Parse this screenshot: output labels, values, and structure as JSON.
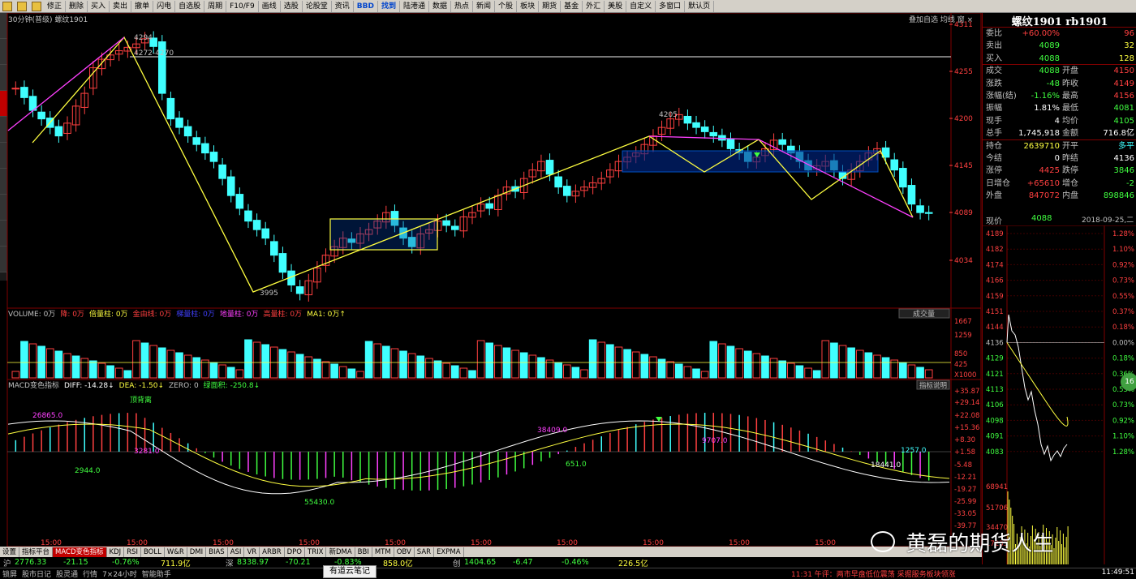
{
  "toolbar": {
    "items": [
      "修正",
      "删除",
      "买入",
      "卖出",
      "撤单",
      "闪电",
      "自选股",
      "周期",
      "F10/F9",
      "画线",
      "选股",
      "论股堂",
      "资讯",
      "BBD",
      "找到",
      "陆港通",
      "数据",
      "热点",
      "新闻",
      "个股",
      "板块",
      "期货",
      "基金",
      "外汇",
      "美股",
      "自定义",
      "多窗口",
      "默认页"
    ]
  },
  "chart": {
    "title": "30分钟(普级) 螺纹1901",
    "tools": "叠加自选 均线 窗 ×",
    "price_axis": [
      "4311",
      "4255",
      "4200",
      "4145",
      "4089",
      "4034"
    ],
    "annotations": {
      "high": "4294",
      "range": "4272-4270",
      "low": "3995",
      "mid": "4205"
    }
  },
  "volume": {
    "header_items": [
      {
        "text": "VOLUME: 0万",
        "color": "#c0c0c0"
      },
      {
        "text": "降: 0万",
        "color": "#ff4040"
      },
      {
        "text": "倍量柱: 0万",
        "color": "#ffff40"
      },
      {
        "text": "金由线: 0万",
        "color": "#ff4040"
      },
      {
        "text": "梯量柱: 0万",
        "color": "#4040ff"
      },
      {
        "text": "地量柱: 0万",
        "color": "#ff40ff"
      },
      {
        "text": "高量柱: 0万",
        "color": "#ff4040"
      },
      {
        "text": "MA1: 0万↑",
        "color": "#ffff40"
      }
    ],
    "button": "成交量",
    "axis": [
      "1667",
      "1259",
      "850",
      "425",
      "X1000"
    ]
  },
  "macd": {
    "header_items": [
      {
        "text": "MACD变色指标",
        "color": "#c0c0c0"
      },
      {
        "text": "DIFF: -14.28↓",
        "color": "#ffffff"
      },
      {
        "text": "DEA: -1.50↓",
        "color": "#ffff40"
      },
      {
        "text": "ZERO: 0",
        "color": "#c0c0c0"
      },
      {
        "text": "绿面积: -250.8↓",
        "color": "#40ff40"
      }
    ],
    "button": "指标说明",
    "axis": [
      "+35.87",
      "+29.14",
      "+22.08",
      "+15.36",
      "+8.30",
      "+1.58",
      "-5.48",
      "-12.21",
      "-19.27",
      "-25.99",
      "-33.05",
      "-39.77"
    ],
    "labels": [
      "26865.0",
      "顶背离",
      "3281.0",
      "2944.0",
      "55430.0",
      "38409.0",
      "651.0",
      "9707.0",
      "18441.0",
      "1257.0"
    ]
  },
  "time_axis": [
    "15:00",
    "15:00",
    "15:00",
    "15:00",
    "15:00",
    "15:00",
    "15:00",
    "15:00",
    "15:00",
    "15:00"
  ],
  "right_panel": {
    "title": "螺纹1901 rb1901",
    "rows": [
      {
        "l1": "委比",
        "v1": "+60.00%",
        "c1": "up",
        "l2": "",
        "v2": "96",
        "c2": "up"
      },
      {
        "l1": "卖出",
        "v1": "4089",
        "c1": "dn",
        "l2": "",
        "v2": "32",
        "c2": "yl"
      },
      {
        "l1": "买入",
        "v1": "4088",
        "c1": "dn",
        "l2": "",
        "v2": "128",
        "c2": "yl"
      },
      {
        "l1": "成交",
        "v1": "4088",
        "c1": "dn",
        "l2": "开盘",
        "v2": "4150",
        "c2": "up"
      },
      {
        "l1": "涨跌",
        "v1": "-48",
        "c1": "dn",
        "l2": "昨收",
        "v2": "4149",
        "c2": "up"
      },
      {
        "l1": "涨幅(结)",
        "v1": "-1.16%",
        "c1": "dn",
        "l2": "最高",
        "v2": "4156",
        "c2": "up"
      },
      {
        "l1": "振幅",
        "v1": "1.81%",
        "c1": "wh",
        "l2": "最低",
        "v2": "4081",
        "c2": "dn"
      },
      {
        "l1": "现手",
        "v1": "4",
        "c1": "wh",
        "l2": "均价",
        "v2": "4105",
        "c2": "dn"
      },
      {
        "l1": "总手",
        "v1": "1,745,918",
        "c1": "wh",
        "l2": "金额",
        "v2": "716.8亿",
        "c2": "wh"
      },
      {
        "l1": "持仓",
        "v1": "2639710",
        "c1": "yl",
        "l2": "开平",
        "v2": "多平",
        "c2": "cy"
      },
      {
        "l1": "今结",
        "v1": "0",
        "c1": "wh",
        "l2": "昨结",
        "v2": "4136",
        "c2": "wh"
      },
      {
        "l1": "涨停",
        "v1": "4425",
        "c1": "up",
        "l2": "跌停",
        "v2": "3846",
        "c2": "dn"
      },
      {
        "l1": "日增仓",
        "v1": "+65610",
        "c1": "up",
        "l2": "增仓",
        "v2": "-2",
        "c2": "dn"
      },
      {
        "l1": "外盘",
        "v1": "847072",
        "c1": "up",
        "l2": "内盘",
        "v2": "898846",
        "c2": "dn"
      }
    ],
    "current_price_label": "现价",
    "current_price": "4088",
    "date": "2018-09-25,二",
    "tick_prices": [
      "4189",
      "4182",
      "4174",
      "4166",
      "4159",
      "4151",
      "4144",
      "4136",
      "4129",
      "4121",
      "4113",
      "4106",
      "4098",
      "4091",
      "4083"
    ],
    "tick_pcts": [
      "1.28%",
      "1.10%",
      "0.92%",
      "0.73%",
      "0.55%",
      "0.37%",
      "0.18%",
      "0.00%",
      "0.18%",
      "0.36%",
      "0.55%",
      "0.73%",
      "0.92%",
      "1.10%",
      "1.28%"
    ],
    "vol_ticks": [
      "68941",
      "51706",
      "34470",
      "17235"
    ]
  },
  "tabs": [
    "设置",
    "指标平台",
    "MACD变色指标",
    "KDJ",
    "RSI",
    "BOLL",
    "W&R",
    "DMI",
    "BIAS",
    "ASI",
    "VR",
    "ARBR",
    "DPO",
    "TRIX",
    "新DMA",
    "BBI",
    "MTM",
    "OBV",
    "SAR",
    "EXPMA"
  ],
  "status1": [
    {
      "text": "沪",
      "c": "#c0c0c0"
    },
    {
      "text": "2776.33",
      "c": "#40ff40"
    },
    {
      "text": "-21.15",
      "c": "#40ff40"
    },
    {
      "text": "-0.76%",
      "c": "#40ff40"
    },
    {
      "text": "711.9亿",
      "c": "#ffff40"
    },
    {
      "text": "深",
      "c": "#c0c0c0"
    },
    {
      "text": "8338.97",
      "c": "#40ff40"
    },
    {
      "text": "-70.21",
      "c": "#40ff40"
    },
    {
      "text": "-0.83%",
      "c": "#40ff40"
    },
    {
      "text": "858.0亿",
      "c": "#ffff40"
    },
    {
      "text": "创",
      "c": "#c0c0c0"
    },
    {
      "text": "1404.65",
      "c": "#40ff40"
    },
    {
      "text": "-6.47",
      "c": "#40ff40"
    },
    {
      "text": "-0.46%",
      "c": "#40ff40"
    },
    {
      "text": "226.5亿",
      "c": "#ffff40"
    }
  ],
  "status2": [
    "锁屏",
    "股市日记",
    "股灵通",
    "行情",
    "7×24小时",
    "智能助手"
  ],
  "popup": "有道云笔记",
  "news": "11:31 午评：两市早盘低位震荡 采掘服务板块领涨",
  "clock": "11:49:51",
  "float_btn": "16",
  "watermark": "黄磊的期货人生"
}
